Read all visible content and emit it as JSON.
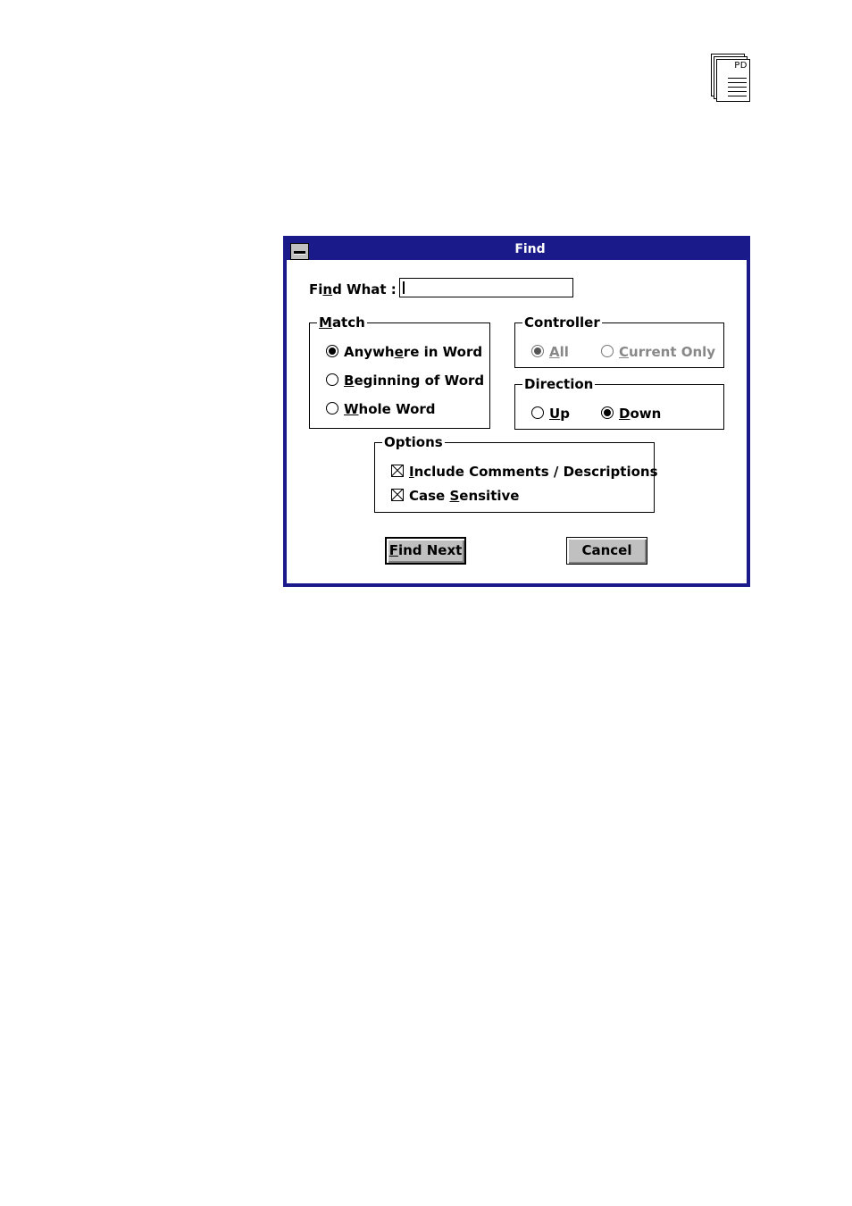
{
  "logo": {
    "label": "PD"
  },
  "dialog": {
    "title": "Find",
    "find_what_label": "Find What :",
    "find_what_value": "",
    "match": {
      "title": "Match",
      "options": [
        "Anywhere in Word",
        "Beginning of Word",
        "Whole Word"
      ],
      "selected": "Anywhere in Word"
    },
    "controller": {
      "title": "Controller",
      "options": [
        "All",
        "Current Only"
      ],
      "selected": "All",
      "disabled": true
    },
    "direction": {
      "title": "Direction",
      "options": [
        "Up",
        "Down"
      ],
      "selected": "Down"
    },
    "options": {
      "title": "Options",
      "include_comments": {
        "label": "Include Comments / Descriptions",
        "checked": true
      },
      "case_sensitive": {
        "label": "Case Sensitive",
        "checked": true
      }
    },
    "buttons": {
      "find_next": "Find Next",
      "cancel": "Cancel"
    }
  },
  "colors": {
    "titlebar": "#1a1a8a",
    "button_face": "#c0c0c0"
  }
}
